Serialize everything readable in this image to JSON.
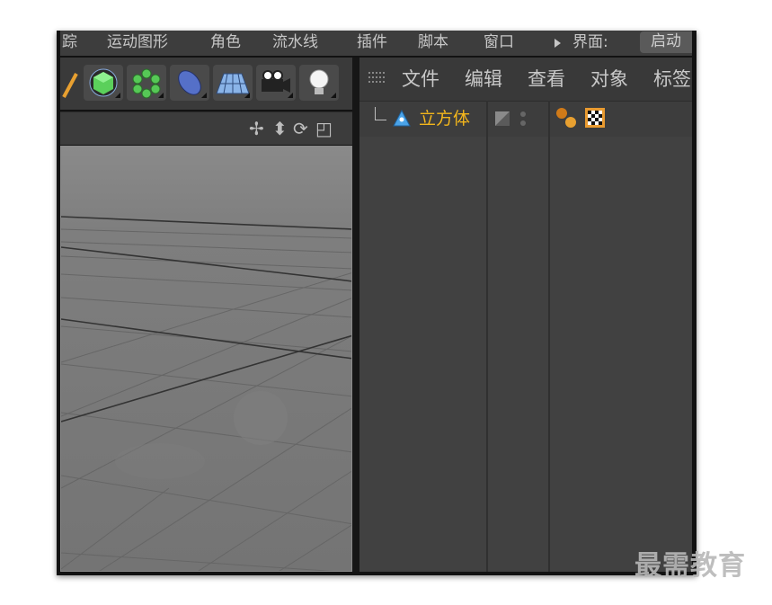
{
  "menubar": {
    "items": [
      "踪",
      "运动图形",
      "角色",
      "流水线",
      "插件",
      "脚本",
      "窗口"
    ],
    "layout_label": "界面:",
    "layout_value": "启动"
  },
  "toolbar": {
    "tools": [
      "cube-object-icon",
      "cloner-icon",
      "deformer-icon",
      "floor-icon",
      "camera-icon",
      "light-icon"
    ]
  },
  "viewport": {
    "nav_icons": [
      "move-icon",
      "pan-icon",
      "rotate-icon",
      "maximize-icon"
    ]
  },
  "object_manager": {
    "menu": [
      "文件",
      "编辑",
      "查看",
      "对象",
      "标签"
    ],
    "objects": [
      {
        "name": "立方体",
        "icon": "cube-primitive-icon",
        "name_color": "#f3b61c"
      }
    ]
  },
  "watermark": "最需教育"
}
